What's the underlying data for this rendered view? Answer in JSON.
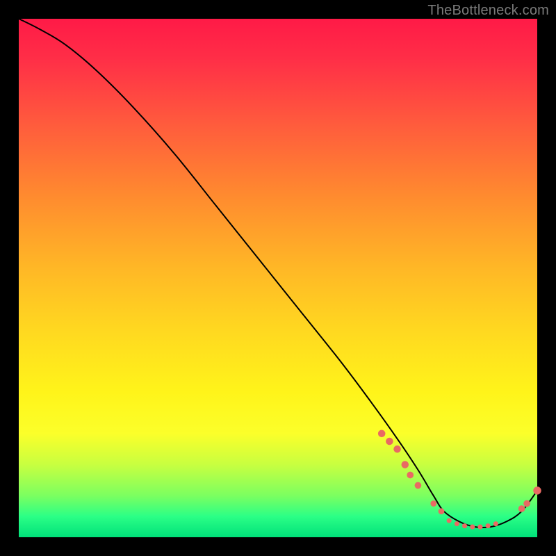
{
  "watermark": "TheBottleneck.com",
  "chart_data": {
    "type": "line",
    "title": "",
    "xlabel": "",
    "ylabel": "",
    "xlim": [
      0,
      100
    ],
    "ylim": [
      0,
      100
    ],
    "grid": false,
    "legend": false,
    "series": [
      {
        "name": "bottleneck-curve",
        "x": [
          0,
          4,
          9,
          15,
          22,
          30,
          38,
          46,
          54,
          62,
          68,
          73,
          77,
          80,
          82,
          85,
          88,
          91,
          94,
          97,
          100
        ],
        "y": [
          100,
          98,
          95,
          90,
          83,
          74,
          64,
          54,
          44,
          34,
          26,
          19,
          13,
          8,
          5,
          3,
          2,
          2,
          3,
          5,
          9
        ]
      }
    ],
    "markers": {
      "name": "highlight-points",
      "color": "#e96a63",
      "points": [
        {
          "x": 70.0,
          "y": 20.0,
          "r": 2.4
        },
        {
          "x": 71.5,
          "y": 18.5,
          "r": 2.4
        },
        {
          "x": 73.0,
          "y": 17.0,
          "r": 2.4
        },
        {
          "x": 74.5,
          "y": 14.0,
          "r": 2.4
        },
        {
          "x": 75.5,
          "y": 12.0,
          "r": 2.2
        },
        {
          "x": 77.0,
          "y": 10.0,
          "r": 2.2
        },
        {
          "x": 80.0,
          "y": 6.5,
          "r": 2.0
        },
        {
          "x": 81.5,
          "y": 5.0,
          "r": 2.0
        },
        {
          "x": 83.0,
          "y": 3.2,
          "r": 1.6
        },
        {
          "x": 84.5,
          "y": 2.6,
          "r": 1.6
        },
        {
          "x": 86.0,
          "y": 2.2,
          "r": 1.6
        },
        {
          "x": 87.5,
          "y": 2.0,
          "r": 1.6
        },
        {
          "x": 89.0,
          "y": 2.0,
          "r": 1.6
        },
        {
          "x": 90.5,
          "y": 2.2,
          "r": 1.6
        },
        {
          "x": 92.0,
          "y": 2.6,
          "r": 1.6
        },
        {
          "x": 97.0,
          "y": 5.5,
          "r": 2.2
        },
        {
          "x": 98.0,
          "y": 6.5,
          "r": 2.2
        },
        {
          "x": 100.0,
          "y": 9.0,
          "r": 2.6
        }
      ]
    }
  }
}
